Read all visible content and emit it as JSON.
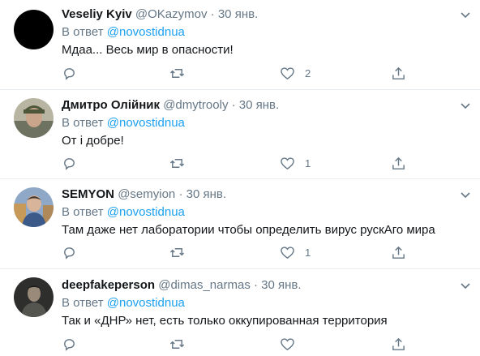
{
  "reply_prefix": "В ответ",
  "tweets": [
    {
      "name": "Veseliy Kyiv",
      "handle": "@OKazymov",
      "date": "30 янв.",
      "reply_to": "@novostidnua",
      "text": "Мдаа... Весь мир в опасности!",
      "likes": "2",
      "avatar_color": "#000000"
    },
    {
      "name": "Дмитро Олійник",
      "handle": "@dmytrooly",
      "date": "30 янв.",
      "reply_to": "@novostidnua",
      "text": "От і добре!",
      "likes": "1",
      "avatar_color": "#7a8064"
    },
    {
      "name": "SEMYON",
      "handle": "@semyion",
      "date": "30 янв.",
      "reply_to": "@novostidnua",
      "text": "Там даже нет лаборатории чтобы определить вирус рускАго мира",
      "likes": "1",
      "avatar_color": "#5a7ab0"
    },
    {
      "name": "deepfakeperson",
      "handle": "@dimas_narmas",
      "date": "30 янв.",
      "reply_to": "@novostidnua",
      "text": "Так и «ДНР» нет, есть только оккупированная территория",
      "likes": "",
      "avatar_color": "#3a3a38"
    }
  ],
  "colors": {
    "accent": "#1da1f2",
    "muted": "#657786",
    "border": "#e6ecf0"
  }
}
